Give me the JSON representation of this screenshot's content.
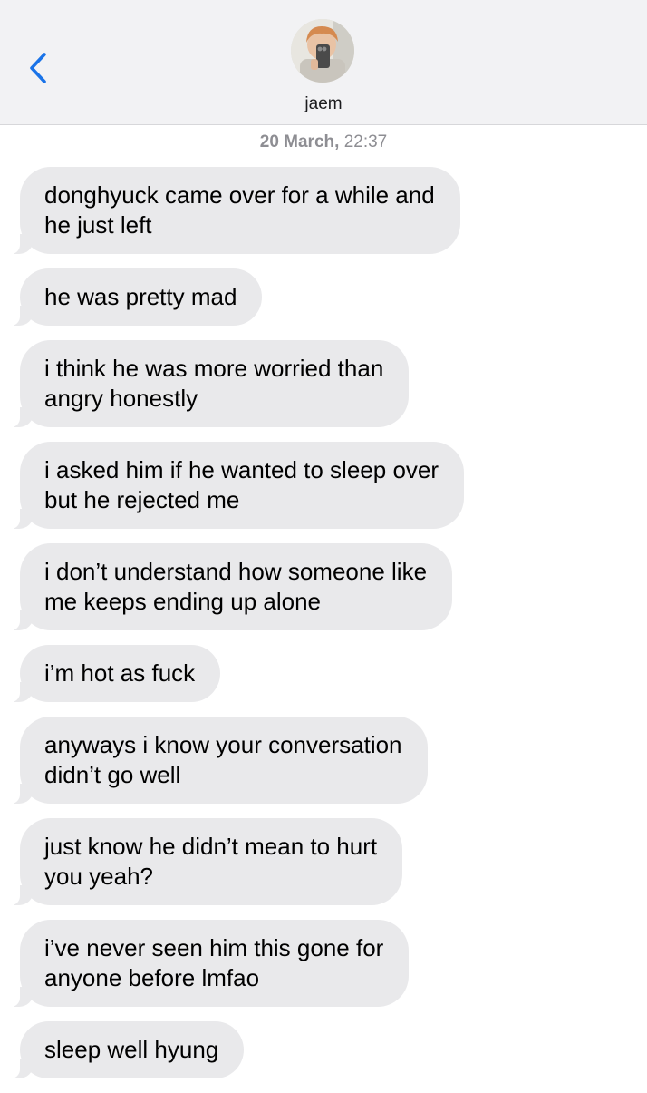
{
  "header": {
    "back_icon": "chevron-left-icon",
    "contact_name": "jaem",
    "avatar_icon": "contact-photo"
  },
  "timestamp": {
    "date": "20 March,",
    "time": "22:37"
  },
  "messages": [
    {
      "text": "donghyuck came over for a while and\nhe just left"
    },
    {
      "text": "he was pretty mad"
    },
    {
      "text": "i think he was more worried than\nangry honestly"
    },
    {
      "text": "i asked him if he wanted to sleep over\nbut he rejected me"
    },
    {
      "text": "i don’t understand how someone like\nme keeps ending up alone"
    },
    {
      "text": "i’m hot as fuck"
    },
    {
      "text": "anyways i know your conversation\ndidn’t go well"
    },
    {
      "text": "just know he didn’t mean to hurt\nyou yeah?"
    },
    {
      "text": "i’ve never seen him this gone for\nanyone before lmfao"
    },
    {
      "text": "sleep well hyung"
    }
  ],
  "colors": {
    "header_bg": "#f2f2f4",
    "bubble_bg": "#e9e9eb",
    "accent_blue": "#1a73e8",
    "timestamp_gray": "#8e8e93"
  }
}
